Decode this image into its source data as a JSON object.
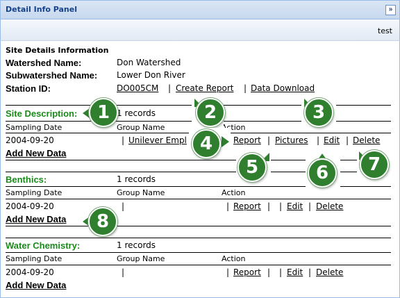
{
  "panel": {
    "title": "Detail Info Panel",
    "collapse_icon": "double-chevron-right-icon"
  },
  "toolbar": {
    "user": "test"
  },
  "site_info": {
    "heading": "Site Details Information",
    "watershed_label": "Watershed Name:",
    "watershed_value": "Don Watershed",
    "subwatershed_label": "Subwatershed Name:",
    "subwatershed_value": "Lower Don River",
    "station_label": "Station ID:",
    "station_value": "DO005CM",
    "create_report": "Create Report",
    "data_download": "Data Download",
    "sep": "|"
  },
  "columns": {
    "date": "Sampling Date",
    "group": "Group Name",
    "action": "Action"
  },
  "sections": {
    "site_description": {
      "title": "Site Description:",
      "records": "1 records",
      "row": {
        "date": "2004-09-20",
        "group": "Unilever Empl",
        "report": "Report",
        "pictures": "Pictures",
        "edit": "Edit",
        "delete": "Delete"
      },
      "add": "Add New Data"
    },
    "benthics": {
      "title": "Benthics:",
      "records": "1 records",
      "row": {
        "date": "2004-09-20",
        "report": "Report",
        "edit": "Edit",
        "delete": "Delete"
      },
      "add": "Add New Data"
    },
    "water_chemistry": {
      "title": "Water Chemistry:",
      "records": "1 records",
      "row": {
        "date": "2004-09-20",
        "report": "Report",
        "edit": "Edit",
        "delete": "Delete"
      },
      "add": "Add New Data"
    }
  },
  "callouts": [
    "1",
    "2",
    "3",
    "4",
    "5",
    "6",
    "7",
    "8"
  ],
  "colors": {
    "callout": "#2f7f2f",
    "section_title": "#1a8a1a",
    "header_text": "#15428b"
  }
}
